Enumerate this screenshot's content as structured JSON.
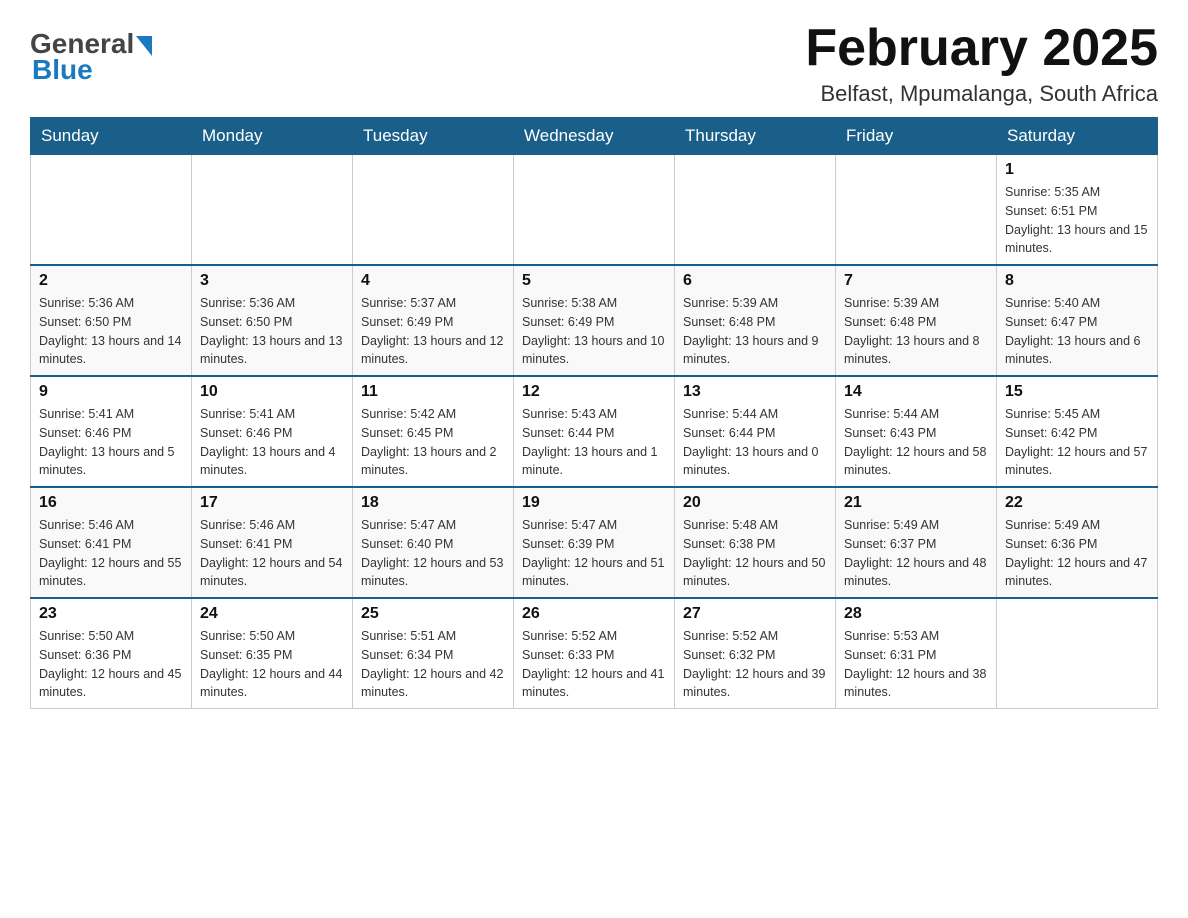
{
  "header": {
    "logo_general": "General",
    "logo_blue": "Blue",
    "title": "February 2025",
    "location": "Belfast, Mpumalanga, South Africa"
  },
  "days_of_week": [
    "Sunday",
    "Monday",
    "Tuesday",
    "Wednesday",
    "Thursday",
    "Friday",
    "Saturday"
  ],
  "weeks": [
    [
      {
        "day": "",
        "sunrise": "",
        "sunset": "",
        "daylight": ""
      },
      {
        "day": "",
        "sunrise": "",
        "sunset": "",
        "daylight": ""
      },
      {
        "day": "",
        "sunrise": "",
        "sunset": "",
        "daylight": ""
      },
      {
        "day": "",
        "sunrise": "",
        "sunset": "",
        "daylight": ""
      },
      {
        "day": "",
        "sunrise": "",
        "sunset": "",
        "daylight": ""
      },
      {
        "day": "",
        "sunrise": "",
        "sunset": "",
        "daylight": ""
      },
      {
        "day": "1",
        "sunrise": "Sunrise: 5:35 AM",
        "sunset": "Sunset: 6:51 PM",
        "daylight": "Daylight: 13 hours and 15 minutes."
      }
    ],
    [
      {
        "day": "2",
        "sunrise": "Sunrise: 5:36 AM",
        "sunset": "Sunset: 6:50 PM",
        "daylight": "Daylight: 13 hours and 14 minutes."
      },
      {
        "day": "3",
        "sunrise": "Sunrise: 5:36 AM",
        "sunset": "Sunset: 6:50 PM",
        "daylight": "Daylight: 13 hours and 13 minutes."
      },
      {
        "day": "4",
        "sunrise": "Sunrise: 5:37 AM",
        "sunset": "Sunset: 6:49 PM",
        "daylight": "Daylight: 13 hours and 12 minutes."
      },
      {
        "day": "5",
        "sunrise": "Sunrise: 5:38 AM",
        "sunset": "Sunset: 6:49 PM",
        "daylight": "Daylight: 13 hours and 10 minutes."
      },
      {
        "day": "6",
        "sunrise": "Sunrise: 5:39 AM",
        "sunset": "Sunset: 6:48 PM",
        "daylight": "Daylight: 13 hours and 9 minutes."
      },
      {
        "day": "7",
        "sunrise": "Sunrise: 5:39 AM",
        "sunset": "Sunset: 6:48 PM",
        "daylight": "Daylight: 13 hours and 8 minutes."
      },
      {
        "day": "8",
        "sunrise": "Sunrise: 5:40 AM",
        "sunset": "Sunset: 6:47 PM",
        "daylight": "Daylight: 13 hours and 6 minutes."
      }
    ],
    [
      {
        "day": "9",
        "sunrise": "Sunrise: 5:41 AM",
        "sunset": "Sunset: 6:46 PM",
        "daylight": "Daylight: 13 hours and 5 minutes."
      },
      {
        "day": "10",
        "sunrise": "Sunrise: 5:41 AM",
        "sunset": "Sunset: 6:46 PM",
        "daylight": "Daylight: 13 hours and 4 minutes."
      },
      {
        "day": "11",
        "sunrise": "Sunrise: 5:42 AM",
        "sunset": "Sunset: 6:45 PM",
        "daylight": "Daylight: 13 hours and 2 minutes."
      },
      {
        "day": "12",
        "sunrise": "Sunrise: 5:43 AM",
        "sunset": "Sunset: 6:44 PM",
        "daylight": "Daylight: 13 hours and 1 minute."
      },
      {
        "day": "13",
        "sunrise": "Sunrise: 5:44 AM",
        "sunset": "Sunset: 6:44 PM",
        "daylight": "Daylight: 13 hours and 0 minutes."
      },
      {
        "day": "14",
        "sunrise": "Sunrise: 5:44 AM",
        "sunset": "Sunset: 6:43 PM",
        "daylight": "Daylight: 12 hours and 58 minutes."
      },
      {
        "day": "15",
        "sunrise": "Sunrise: 5:45 AM",
        "sunset": "Sunset: 6:42 PM",
        "daylight": "Daylight: 12 hours and 57 minutes."
      }
    ],
    [
      {
        "day": "16",
        "sunrise": "Sunrise: 5:46 AM",
        "sunset": "Sunset: 6:41 PM",
        "daylight": "Daylight: 12 hours and 55 minutes."
      },
      {
        "day": "17",
        "sunrise": "Sunrise: 5:46 AM",
        "sunset": "Sunset: 6:41 PM",
        "daylight": "Daylight: 12 hours and 54 minutes."
      },
      {
        "day": "18",
        "sunrise": "Sunrise: 5:47 AM",
        "sunset": "Sunset: 6:40 PM",
        "daylight": "Daylight: 12 hours and 53 minutes."
      },
      {
        "day": "19",
        "sunrise": "Sunrise: 5:47 AM",
        "sunset": "Sunset: 6:39 PM",
        "daylight": "Daylight: 12 hours and 51 minutes."
      },
      {
        "day": "20",
        "sunrise": "Sunrise: 5:48 AM",
        "sunset": "Sunset: 6:38 PM",
        "daylight": "Daylight: 12 hours and 50 minutes."
      },
      {
        "day": "21",
        "sunrise": "Sunrise: 5:49 AM",
        "sunset": "Sunset: 6:37 PM",
        "daylight": "Daylight: 12 hours and 48 minutes."
      },
      {
        "day": "22",
        "sunrise": "Sunrise: 5:49 AM",
        "sunset": "Sunset: 6:36 PM",
        "daylight": "Daylight: 12 hours and 47 minutes."
      }
    ],
    [
      {
        "day": "23",
        "sunrise": "Sunrise: 5:50 AM",
        "sunset": "Sunset: 6:36 PM",
        "daylight": "Daylight: 12 hours and 45 minutes."
      },
      {
        "day": "24",
        "sunrise": "Sunrise: 5:50 AM",
        "sunset": "Sunset: 6:35 PM",
        "daylight": "Daylight: 12 hours and 44 minutes."
      },
      {
        "day": "25",
        "sunrise": "Sunrise: 5:51 AM",
        "sunset": "Sunset: 6:34 PM",
        "daylight": "Daylight: 12 hours and 42 minutes."
      },
      {
        "day": "26",
        "sunrise": "Sunrise: 5:52 AM",
        "sunset": "Sunset: 6:33 PM",
        "daylight": "Daylight: 12 hours and 41 minutes."
      },
      {
        "day": "27",
        "sunrise": "Sunrise: 5:52 AM",
        "sunset": "Sunset: 6:32 PM",
        "daylight": "Daylight: 12 hours and 39 minutes."
      },
      {
        "day": "28",
        "sunrise": "Sunrise: 5:53 AM",
        "sunset": "Sunset: 6:31 PM",
        "daylight": "Daylight: 12 hours and 38 minutes."
      },
      {
        "day": "",
        "sunrise": "",
        "sunset": "",
        "daylight": ""
      }
    ]
  ]
}
